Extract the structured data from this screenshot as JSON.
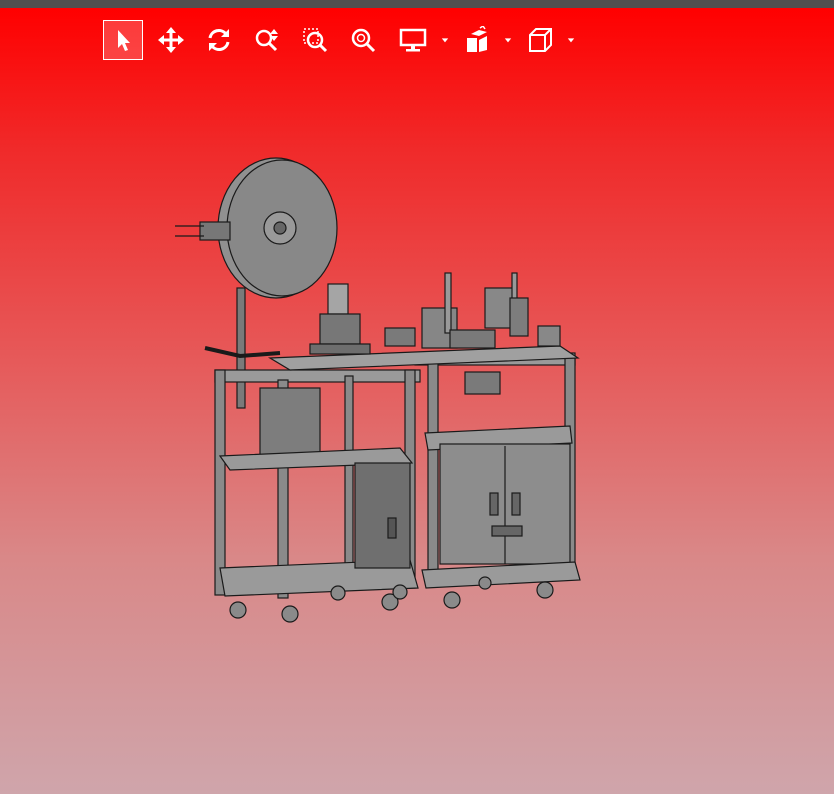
{
  "app": {
    "accent": "#ffffff",
    "background_top": "#ff0000",
    "background_bottom": "#cfa5ab"
  },
  "toolbar": {
    "items": [
      {
        "name": "select",
        "icon": "pointer-arrow-icon",
        "active": true
      },
      {
        "name": "pan",
        "icon": "move-arrows-icon",
        "active": false
      },
      {
        "name": "rotate",
        "icon": "rotate-icon",
        "active": false
      },
      {
        "name": "zoom",
        "icon": "zoom-in-out-icon",
        "active": false
      },
      {
        "name": "zoom-window",
        "icon": "zoom-window-icon",
        "active": false
      },
      {
        "name": "zoom-fit",
        "icon": "zoom-fit-icon",
        "active": false
      },
      {
        "name": "display-mode",
        "icon": "monitor-icon",
        "has_dropdown": true
      },
      {
        "name": "explode",
        "icon": "explode-icon",
        "has_dropdown": true
      },
      {
        "name": "standard-views",
        "icon": "cube-icon",
        "has_dropdown": true
      }
    ]
  },
  "model": {
    "name_icon": "cad-machine-model",
    "color": "#8c8c8c",
    "edge_color": "#1a1a1a"
  }
}
